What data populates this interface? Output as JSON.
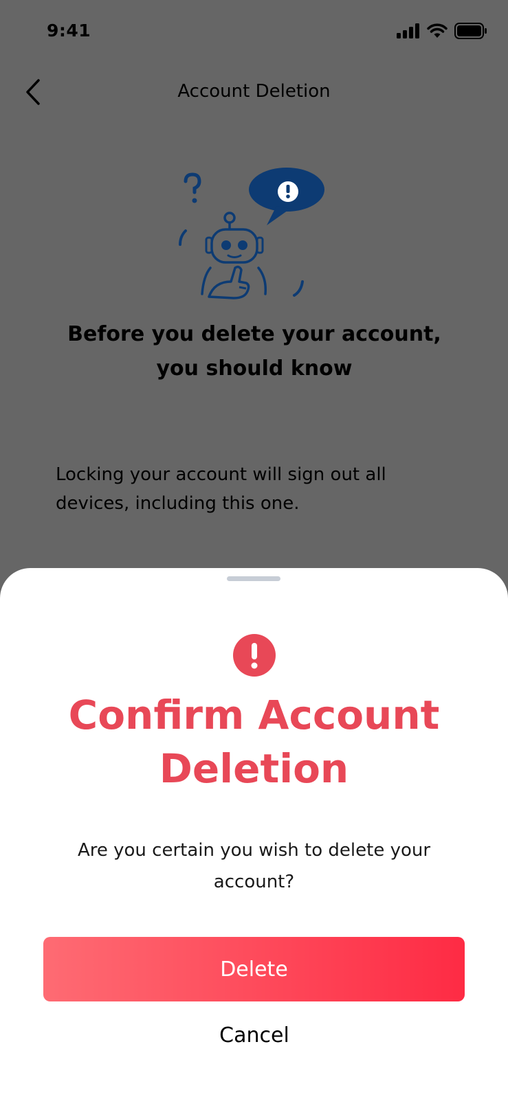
{
  "status_bar": {
    "time": "9:41"
  },
  "nav": {
    "title": "Account Deletion"
  },
  "content": {
    "headline": "Before you delete your account, you should know",
    "info": "Locking your account will sign out all devices, including this one."
  },
  "sheet": {
    "title": "Confirm Account Deletion",
    "message": "Are you certain you wish to delete your account?",
    "delete_label": "Delete",
    "cancel_label": "Cancel"
  },
  "colors": {
    "overlay_background": "#666666",
    "accent_red": "#e84857",
    "illustration_blue": "#0d3b73",
    "button_gradient_start": "#fe6b73",
    "button_gradient_end": "#fe2b44"
  },
  "icons": [
    "back-chevron-icon",
    "signal-icon",
    "wifi-icon",
    "battery-icon",
    "robot-illustration",
    "alert-icon"
  ]
}
